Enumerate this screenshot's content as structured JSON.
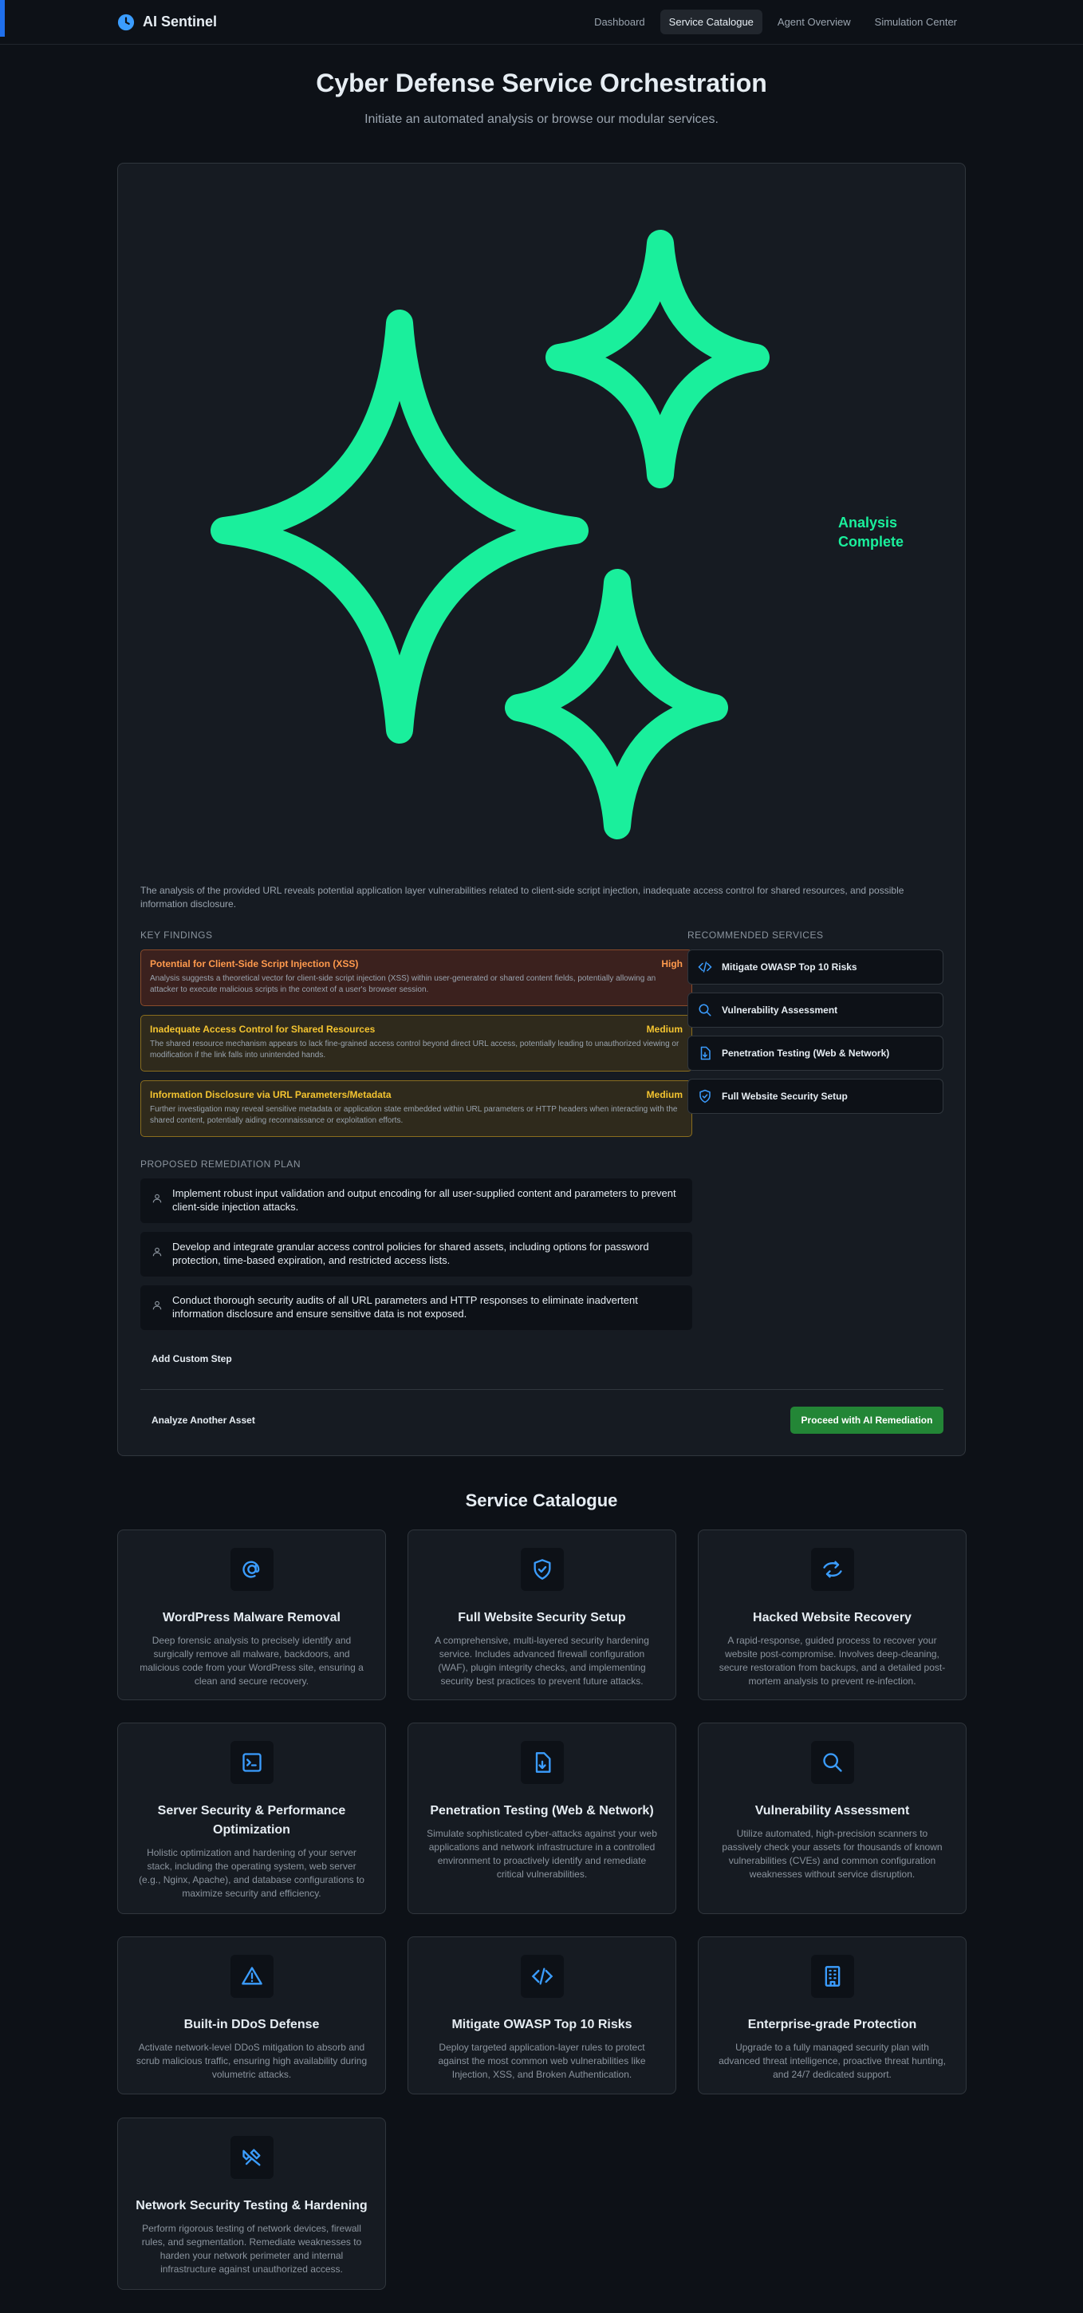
{
  "header": {
    "brand": "AI Sentinel",
    "nav": [
      {
        "label": "Dashboard",
        "active": false
      },
      {
        "label": "Service Catalogue",
        "active": true
      },
      {
        "label": "Agent Overview",
        "active": false
      },
      {
        "label": "Simulation Center",
        "active": false
      }
    ]
  },
  "hero": {
    "title": "Cyber Defense Service Orchestration",
    "subtitle": "Initiate an automated analysis or browse our modular services."
  },
  "analysis": {
    "status": "Analysis Complete",
    "summary": "The analysis of the provided URL reveals potential application layer vulnerabilities related to client-side script injection, inadequate access control for shared resources, and possible information disclosure.",
    "findings_title": "KEY FINDINGS",
    "findings": [
      {
        "title": "Potential for Client-Side Script Injection (XSS)",
        "severity": "High",
        "description": "Analysis suggests a theoretical vector for client-side script injection (XSS) within user-generated or shared content fields, potentially allowing an attacker to execute malicious scripts in the context of a user's browser session."
      },
      {
        "title": "Inadequate Access Control for Shared Resources",
        "severity": "Medium",
        "description": "The shared resource mechanism appears to lack fine-grained access control beyond direct URL access, potentially leading to unauthorized viewing or modification if the link falls into unintended hands."
      },
      {
        "title": "Information Disclosure via URL Parameters/Metadata",
        "severity": "Medium",
        "description": "Further investigation may reveal sensitive metadata or application state embedded within URL parameters or HTTP headers when interacting with the shared content, potentially aiding reconnaissance or exploitation efforts."
      }
    ],
    "services_title": "RECOMMENDED SERVICES",
    "services": [
      {
        "label": "Mitigate OWASP Top 10 Risks",
        "icon": "code-icon"
      },
      {
        "label": "Vulnerability Assessment",
        "icon": "search-icon"
      },
      {
        "label": "Penetration Testing (Web & Network)",
        "icon": "file-download-icon"
      },
      {
        "label": "Full Website Security Setup",
        "icon": "shield-check-icon"
      }
    ],
    "plan_title": "PROPOSED REMEDIATION PLAN",
    "plan": [
      "Implement robust input validation and output encoding for all user-supplied content and parameters to prevent client-side injection attacks.",
      "Develop and integrate granular access control policies for shared assets, including options for password protection, time-based expiration, and restricted access lists.",
      "Conduct thorough security audits of all URL parameters and HTTP responses to eliminate inadvertent information disclosure and ensure sensitive data is not exposed."
    ],
    "add_step": "Add Custom Step",
    "analyze_another": "Analyze Another Asset",
    "proceed": "Proceed with AI Remediation"
  },
  "catalogue": {
    "title": "Service Catalogue",
    "cards": [
      {
        "title": "WordPress Malware Removal",
        "icon": "at-sign-icon",
        "description": "Deep forensic analysis to precisely identify and surgically remove all malware, backdoors, and malicious code from your WordPress site, ensuring a clean and secure recovery."
      },
      {
        "title": "Full Website Security Setup",
        "icon": "shield-check-icon",
        "description": "A comprehensive, multi-layered security hardening service. Includes advanced firewall configuration (WAF), plugin integrity checks, and implementing security best practices to prevent future attacks."
      },
      {
        "title": "Hacked Website Recovery",
        "icon": "recovery-arrows-icon",
        "description": "A rapid-response, guided process to recover your website post-compromise. Involves deep-cleaning, secure restoration from backups, and a detailed post-mortem analysis to prevent re-infection."
      },
      {
        "title": "Server Security & Performance Optimization",
        "icon": "terminal-icon",
        "description": "Holistic optimization and hardening of your server stack, including the operating system, web server (e.g., Nginx, Apache), and database configurations to maximize security and efficiency."
      },
      {
        "title": "Penetration Testing (Web & Network)",
        "icon": "file-download-icon",
        "description": "Simulate sophisticated cyber-attacks against your web applications and network infrastructure in a controlled environment to proactively identify and remediate critical vulnerabilities."
      },
      {
        "title": "Vulnerability Assessment",
        "icon": "search-icon",
        "description": "Utilize automated, high-precision scanners to passively check your assets for thousands of known vulnerabilities (CVEs) and common configuration weaknesses without service disruption."
      },
      {
        "title": "Built-in DDoS Defense",
        "icon": "warning-triangle-icon",
        "description": "Activate network-level DDoS mitigation to absorb and scrub malicious traffic, ensuring high availability during volumetric attacks."
      },
      {
        "title": "Mitigate OWASP Top 10 Risks",
        "icon": "code-icon",
        "description": "Deploy targeted application-layer rules to protect against the most common web vulnerabilities like Injection, XSS, and Broken Authentication."
      },
      {
        "title": "Enterprise-grade Protection",
        "icon": "building-icon",
        "description": "Upgrade to a fully managed security plan with advanced threat intelligence, proactive threat hunting, and 24/7 dedicated support."
      },
      {
        "title": "Network Security Testing & Hardening",
        "icon": "network-tools-icon",
        "description": "Perform rigorous testing of network devices, firewall rules, and segmentation. Remediate weaknesses to harden your network perimeter and internal infrastructure against unauthorized access."
      }
    ]
  },
  "colors": {
    "accent": "#1aef9c",
    "primary_button": "#238636",
    "icon_blue": "#3b9dff",
    "high": "#ff9a4d",
    "medium": "#f4c430"
  }
}
